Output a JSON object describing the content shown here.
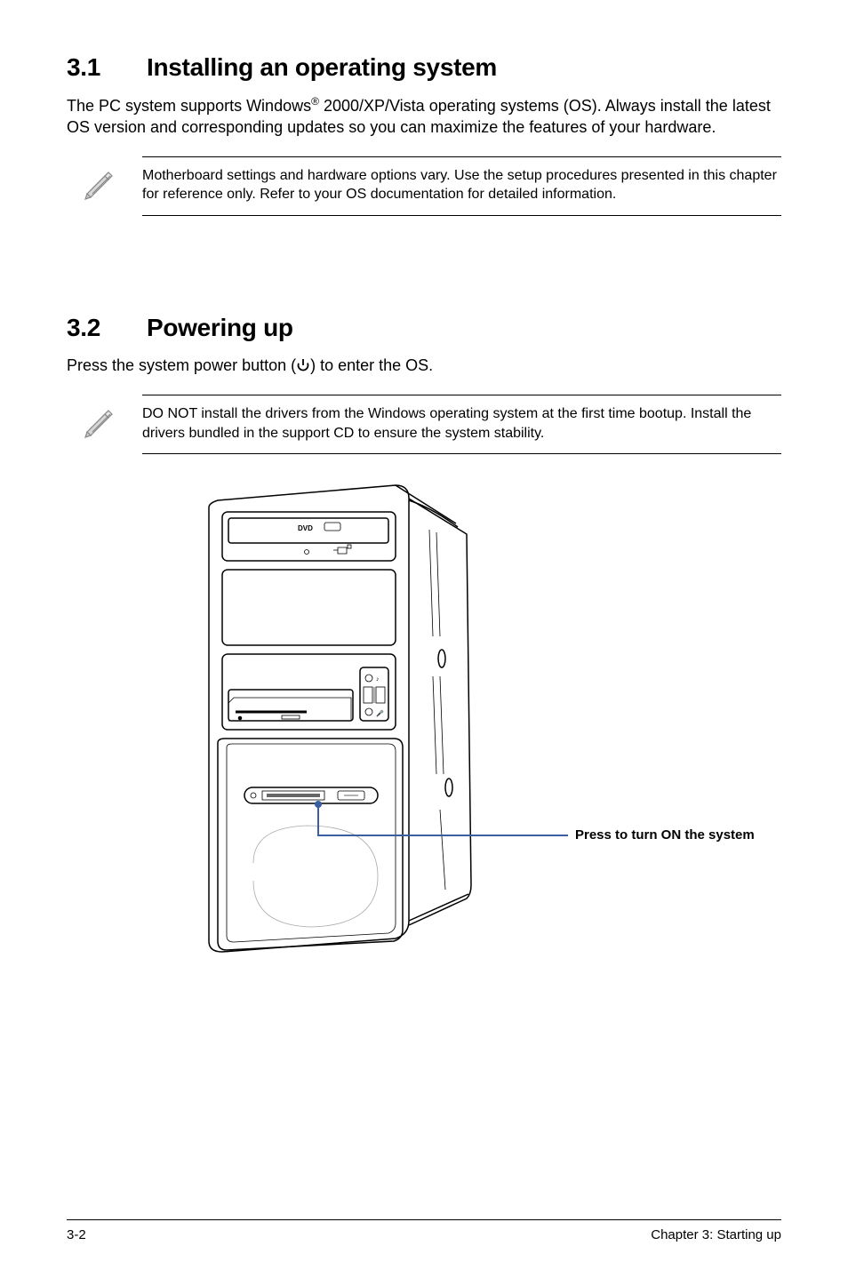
{
  "sections": {
    "s1": {
      "number": "3.1",
      "title": "Installing an operating system",
      "body_pre": "The PC system supports Windows",
      "body_reg": "®",
      "body_post": " 2000/XP/Vista operating systems (OS). Always install the latest OS version and corresponding updates so you can maximize the features of your hardware.",
      "note": "Motherboard settings and hardware options vary. Use the setup procedures presented in this chapter for reference only. Refer to your OS documentation for detailed information."
    },
    "s2": {
      "number": "3.2",
      "title": "Powering up",
      "body_pre": "Press the system power button (",
      "body_post": ") to enter the OS.",
      "note": "DO NOT install the drivers from the Windows operating system at the first time bootup. Install the drivers bundled in the support CD to ensure the system stability.",
      "callout": "Press to turn ON the system"
    }
  },
  "footer": {
    "left": "3-2",
    "right": "Chapter 3: Starting up"
  }
}
